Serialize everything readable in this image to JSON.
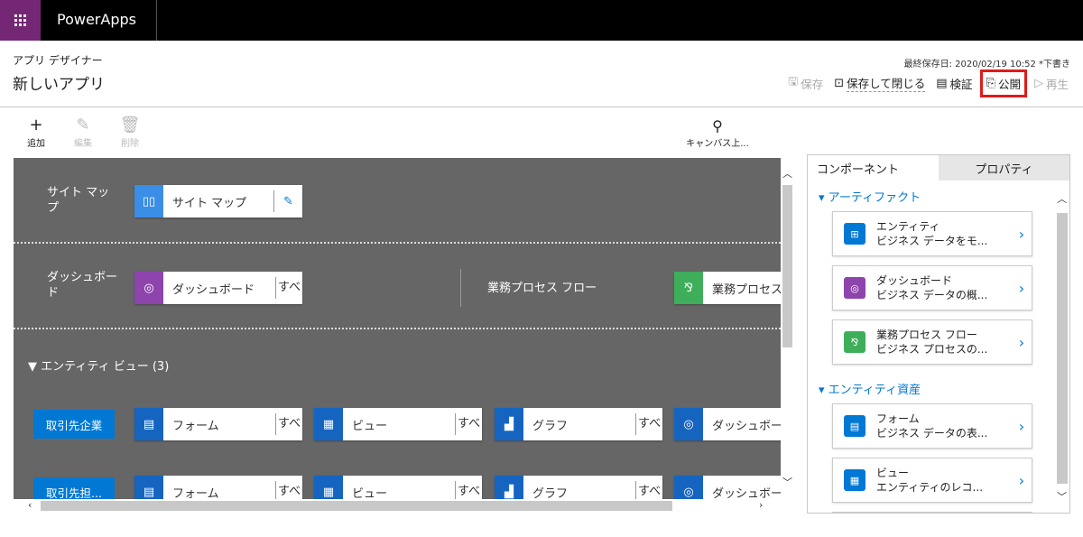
{
  "topbar": {
    "app_name": "PowerApps"
  },
  "header": {
    "designer_label": "アプリ デザイナー",
    "app_title": "新しいアプリ",
    "save_info": "最終保存日: 2020/02/19 10:52 *下書き",
    "commands": {
      "save": "保存",
      "save_close": "保存して閉じる",
      "validate": "検証",
      "publish": "公開",
      "play": "再生"
    }
  },
  "toolbar": {
    "add": "追加",
    "edit": "編集",
    "delete": "削除",
    "canvas_search": "キャンバス上..."
  },
  "canvas": {
    "sitemap_label": "サイト マップ",
    "sitemap_tile": "サイト マップ",
    "dashboard_label": "ダッシュボード",
    "dashboard_tile": "ダッシュボード",
    "dashboard_sub": "すべ",
    "bpf_label": "業務プロセス フロー",
    "bpf_tile": "業務プロセス",
    "entity_view_head": "エンティティ ビュー (3)",
    "rows": [
      {
        "entity": "取引先企業",
        "form": "フォーム",
        "view": "ビュー",
        "chart": "グラフ",
        "dash": "ダッシュボー",
        "sub": "すべ"
      },
      {
        "entity": "取引先担...",
        "form": "フォーム",
        "view": "ビュー",
        "chart": "グラフ",
        "dash": "ダッシュボー",
        "sub": "すべ"
      }
    ]
  },
  "panel": {
    "tabs": [
      "コンポーネント",
      "プロパティ"
    ],
    "groups": [
      {
        "title": "アーティファクト"
      },
      {
        "title": "エンティティ資産"
      }
    ],
    "cards": [
      {
        "title": "エンティティ",
        "desc": "ビジネス データをモ...",
        "icon": "entity-icon",
        "color": "#0078d4"
      },
      {
        "title": "ダッシュボード",
        "desc": "ビジネス データの概...",
        "icon": "dashboard-icon",
        "color": "#8e44ad"
      },
      {
        "title": "業務プロセス フロー",
        "desc": "ビジネス プロセスの...",
        "icon": "process-flow-icon",
        "color": "#3fae5b"
      },
      {
        "title": "フォーム",
        "desc": "ビジネス データの表...",
        "icon": "form-icon",
        "color": "#0078d4"
      },
      {
        "title": "ビュー",
        "desc": "エンティティのレコ...",
        "icon": "view-icon",
        "color": "#0078d4"
      }
    ]
  },
  "colors": {
    "brand": "#742774",
    "accent": "#0078d4",
    "highlight": "#e01a1a"
  }
}
